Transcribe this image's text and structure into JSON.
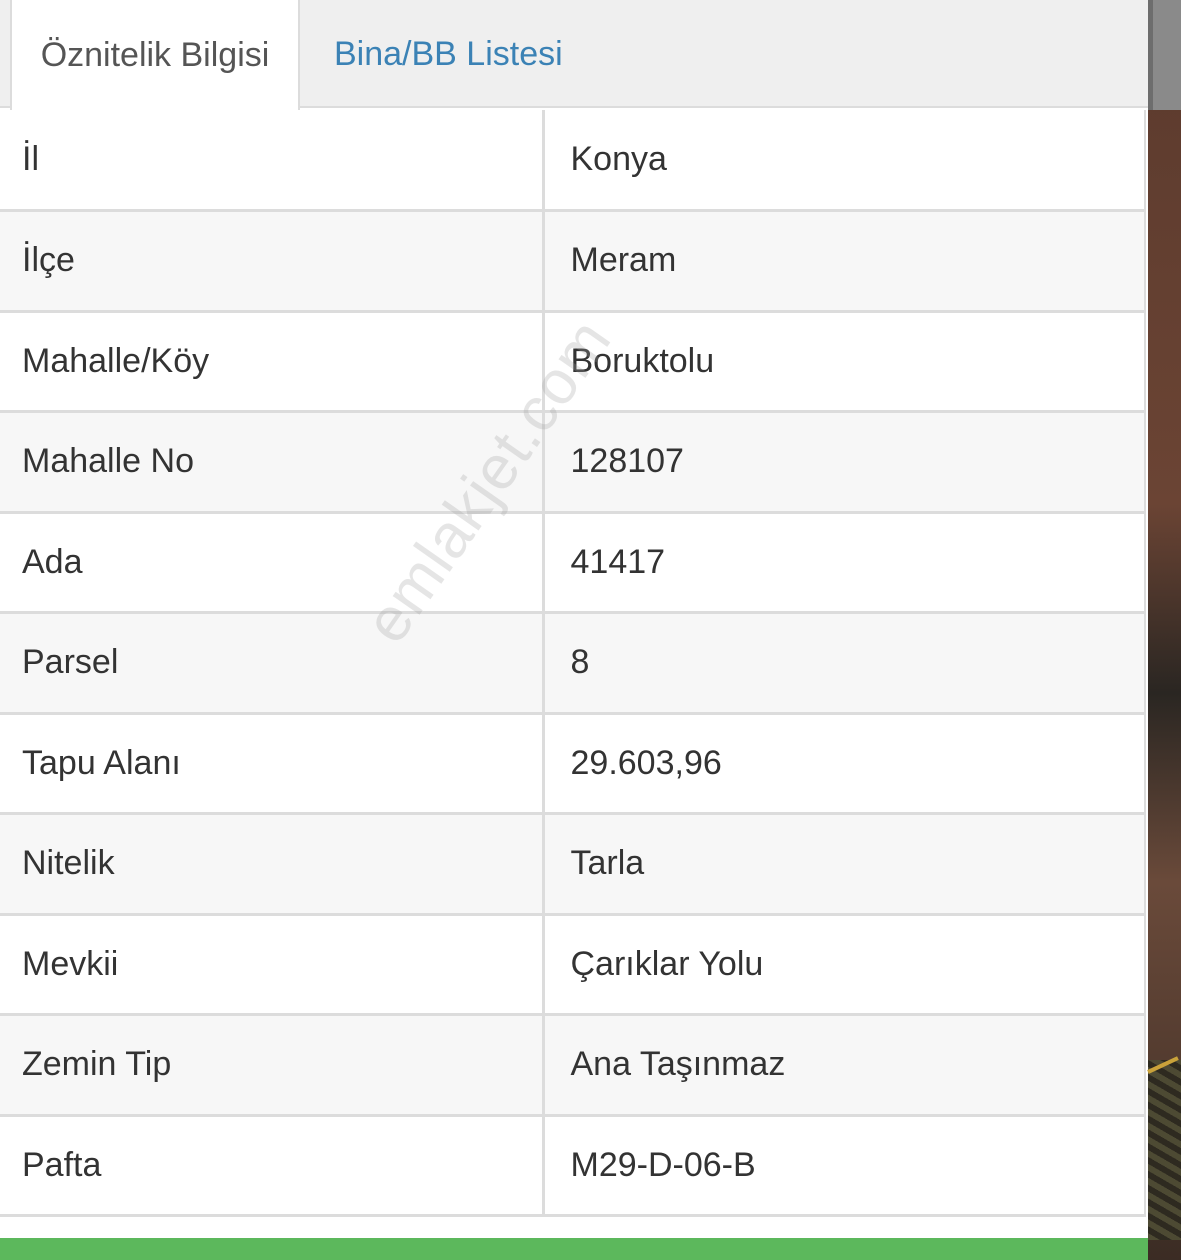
{
  "tabs": [
    {
      "label": "Öznitelik Bilgisi",
      "active": true
    },
    {
      "label": "Bina/BB Listesi",
      "active": false
    }
  ],
  "attributes": [
    {
      "key": "İl",
      "value": "Konya"
    },
    {
      "key": "İlçe",
      "value": "Meram"
    },
    {
      "key": "Mahalle/Köy",
      "value": "Boruktolu"
    },
    {
      "key": "Mahalle No",
      "value": "128107"
    },
    {
      "key": "Ada",
      "value": "41417"
    },
    {
      "key": "Parsel",
      "value": "8"
    },
    {
      "key": "Tapu Alanı",
      "value": "29.603,96"
    },
    {
      "key": "Nitelik",
      "value": "Tarla"
    },
    {
      "key": "Mevkii",
      "value": "Çarıklar Yolu"
    },
    {
      "key": "Zemin Tip",
      "value": "Ana Taşınmaz"
    },
    {
      "key": "Pafta",
      "value": "M29-D-06-B"
    }
  ],
  "watermark": "emlakjet.com",
  "colors": {
    "tab_link": "#3b82b5",
    "action_bar": "#5cb85c"
  }
}
